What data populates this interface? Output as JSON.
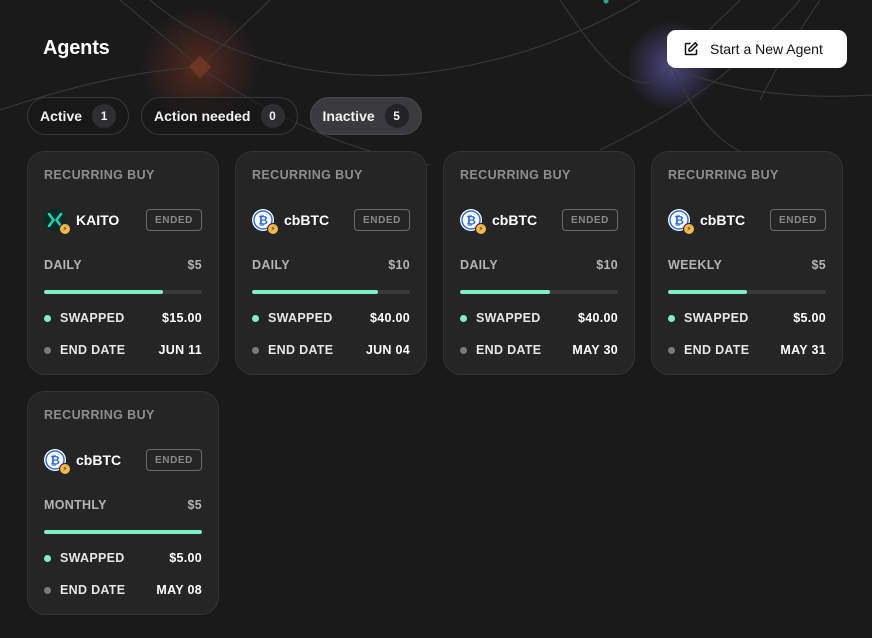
{
  "page": {
    "title": "Agents",
    "new_agent_button": "Start a New Agent",
    "new_agent_icon": "edit-icon"
  },
  "tabs": [
    {
      "label": "Active",
      "count": "1",
      "selected": false
    },
    {
      "label": "Action needed",
      "count": "0",
      "selected": false
    },
    {
      "label": "Inactive",
      "count": "5",
      "selected": true
    }
  ],
  "colors": {
    "background": "#1a1a1b",
    "card": "#252526",
    "progress": "#7ef0c3",
    "badge": "#f2b94b",
    "btc_blue": "#2f6fe0",
    "kaito_teal": "#1ad3b0"
  },
  "cards": [
    {
      "type": "RECURRING BUY",
      "token": "KAITO",
      "icon": "kaito-icon",
      "status": "ENDED",
      "frequency": "DAILY",
      "amount": "$5",
      "progress": 0.75,
      "swapped_label": "SWAPPED",
      "swapped": "$15.00",
      "end_label": "END DATE",
      "end_date": "JUN 11"
    },
    {
      "type": "RECURRING BUY",
      "token": "cbBTC",
      "icon": "bitcoin-icon",
      "status": "ENDED",
      "frequency": "DAILY",
      "amount": "$10",
      "progress": 0.8,
      "swapped_label": "SWAPPED",
      "swapped": "$40.00",
      "end_label": "END DATE",
      "end_date": "JUN 04"
    },
    {
      "type": "RECURRING BUY",
      "token": "cbBTC",
      "icon": "bitcoin-icon",
      "status": "ENDED",
      "frequency": "DAILY",
      "amount": "$10",
      "progress": 0.57,
      "swapped_label": "SWAPPED",
      "swapped": "$40.00",
      "end_label": "END DATE",
      "end_date": "MAY 30"
    },
    {
      "type": "RECURRING BUY",
      "token": "cbBTC",
      "icon": "bitcoin-icon",
      "status": "ENDED",
      "frequency": "WEEKLY",
      "amount": "$5",
      "progress": 0.5,
      "swapped_label": "SWAPPED",
      "swapped": "$5.00",
      "end_label": "END DATE",
      "end_date": "MAY 31"
    },
    {
      "type": "RECURRING BUY",
      "token": "cbBTC",
      "icon": "bitcoin-icon",
      "status": "ENDED",
      "frequency": "MONTHLY",
      "amount": "$5",
      "progress": 1.0,
      "swapped_label": "SWAPPED",
      "swapped": "$5.00",
      "end_label": "END DATE",
      "end_date": "MAY 08"
    }
  ]
}
